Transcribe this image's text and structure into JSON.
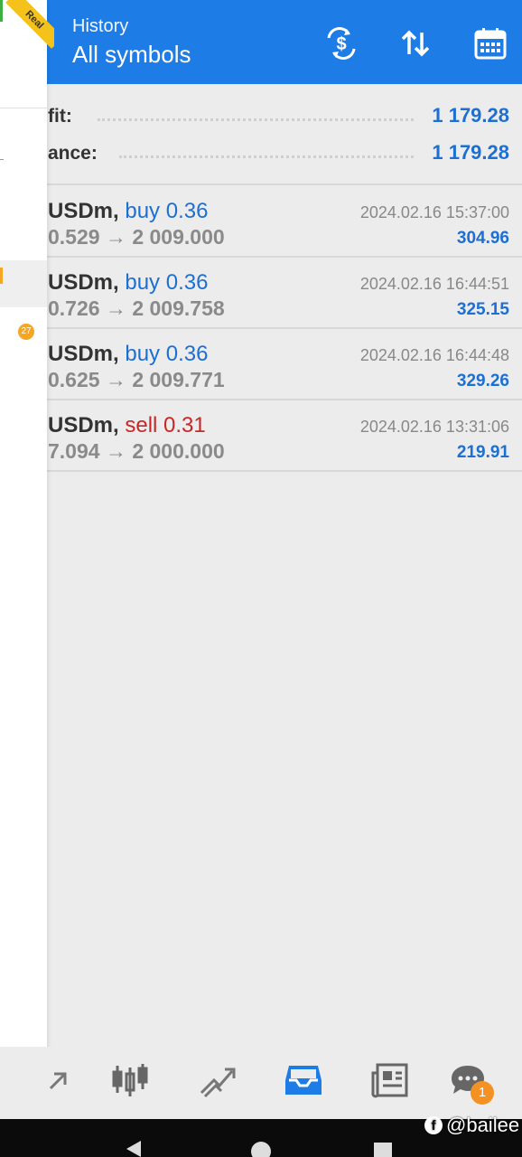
{
  "header": {
    "subtitle": "History",
    "title": "All symbols",
    "actions": [
      "deposit-withdraw-icon",
      "sort-icon",
      "calendar-icon"
    ]
  },
  "summary": [
    {
      "label": "fit:",
      "value": "1 179.28"
    },
    {
      "label": "ance:",
      "value": "1 179.28"
    }
  ],
  "trades": [
    {
      "symbol": "USDm,",
      "direction": "buy",
      "volume_text": "buy 0.36",
      "prices": "0.529 → 2 009.000",
      "time": "2024.02.16 15:37:00",
      "profit": "304.96"
    },
    {
      "symbol": "USDm,",
      "direction": "buy",
      "volume_text": "buy 0.36",
      "prices": "0.726 → 2 009.758",
      "time": "2024.02.16 16:44:51",
      "profit": "325.15"
    },
    {
      "symbol": "USDm,",
      "direction": "buy",
      "volume_text": "buy 0.36",
      "prices": "0.625 → 2 009.771",
      "time": "2024.02.16 16:44:48",
      "profit": "329.26"
    },
    {
      "symbol": "USDm,",
      "direction": "sell",
      "volume_text": "sell 0.31",
      "prices": "7.094 → 2 000.000",
      "time": "2024.02.16 13:31:06",
      "profit": "219.91"
    }
  ],
  "drawer": {
    "ribbon": "Real",
    "badge": "27"
  },
  "bottom_nav": {
    "items": [
      "quotes-icon",
      "chart-icon",
      "trade-icon",
      "history-icon",
      "news-icon",
      "chat-icon"
    ],
    "active": "history-icon",
    "chat_badge": "1"
  },
  "watermark": "@bailee",
  "colors": {
    "appbar": "#1e7ce6",
    "buy": "#1d6fd1",
    "sell": "#c62828",
    "profit": "#1d6fd1",
    "badge": "#f39222"
  }
}
